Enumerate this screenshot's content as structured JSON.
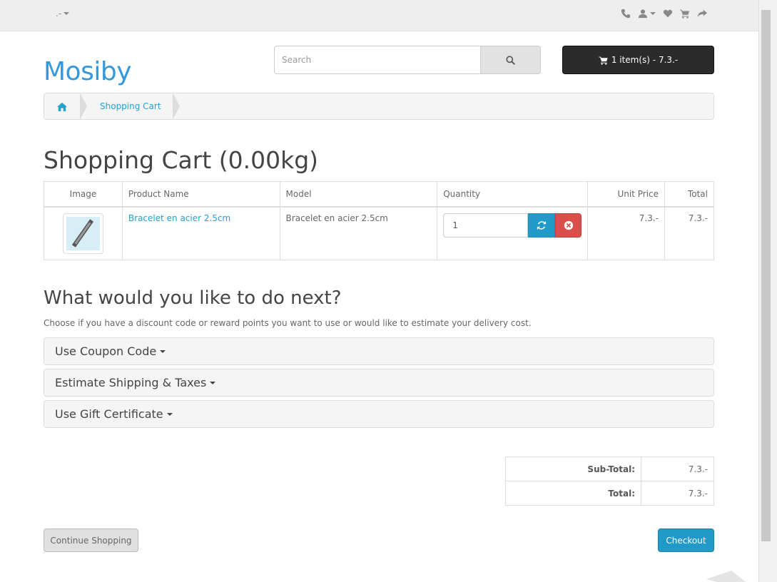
{
  "topbar": {
    "currency_label": ".-",
    "icons": [
      "phone-icon",
      "user-icon",
      "heart-icon",
      "cart-icon",
      "share-icon"
    ]
  },
  "header": {
    "logo": "Mosiby",
    "search_placeholder": "Search",
    "cart_button_label": "1 item(s) - 7.3.-"
  },
  "breadcrumb": {
    "items": [
      "Shopping Cart"
    ]
  },
  "page": {
    "title": "Shopping Cart  (0.00kg)"
  },
  "cart_table": {
    "headers": {
      "image": "Image",
      "name": "Product Name",
      "model": "Model",
      "quantity": "Quantity",
      "unit_price": "Unit Price",
      "total": "Total"
    },
    "rows": [
      {
        "name": "Bracelet en acier 2.5cm",
        "model": "Bracelet en acier 2.5cm",
        "quantity": "1",
        "unit_price": "7.3.-",
        "total": "7.3.-"
      }
    ]
  },
  "next": {
    "title": "What would you like to do next?",
    "description": "Choose if you have a discount code or reward points you want to use or would like to estimate your delivery cost.",
    "panels": [
      "Use Coupon Code",
      "Estimate Shipping & Taxes",
      "Use Gift Certificate"
    ]
  },
  "totals": [
    {
      "label": "Sub-Total:",
      "value": "7.3.-"
    },
    {
      "label": "Total:",
      "value": "7.3.-"
    }
  ],
  "actions": {
    "continue_label": "Continue Shopping",
    "checkout_label": "Checkout"
  },
  "colors": {
    "link": "#23a1d1",
    "primary_button": "#229ac8",
    "danger_button": "#da4f49",
    "cart_button": "#2b2b2b"
  }
}
